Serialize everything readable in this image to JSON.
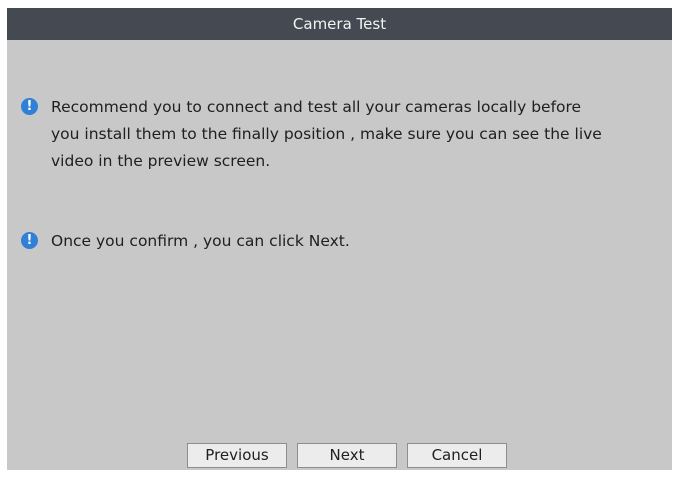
{
  "dialog": {
    "title": "Camera Test",
    "messages": [
      {
        "icon": "info-icon",
        "text": "Recommend you to connect and test all your cameras locally before you install them to the finally position , make sure you can see the live video in the preview screen."
      },
      {
        "icon": "info-icon",
        "text": "Once you confirm , you can click Next."
      }
    ],
    "buttons": {
      "previous": "Previous",
      "next": "Next",
      "cancel": "Cancel"
    }
  },
  "colors": {
    "titlebar": "#454a52",
    "background": "#c8c8c8",
    "info_icon": "#2f80d6"
  }
}
